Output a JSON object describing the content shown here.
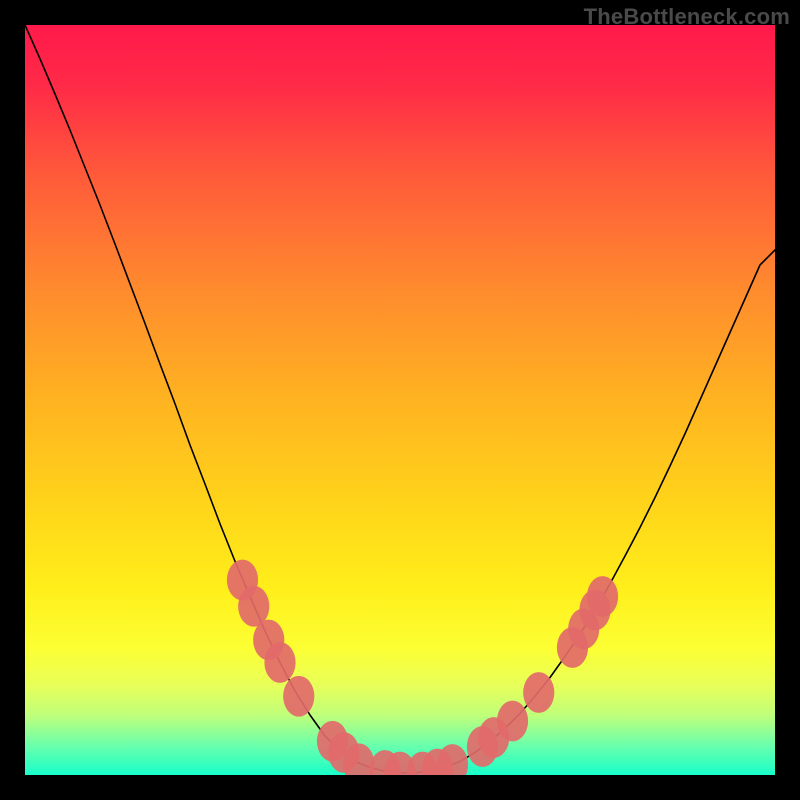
{
  "watermark": "TheBottleneck.com",
  "chart_data": {
    "type": "line",
    "title": "",
    "xlabel": "",
    "ylabel": "",
    "xlim": [
      0,
      100
    ],
    "ylim": [
      0,
      100
    ],
    "background_gradient": {
      "stops": [
        {
          "offset": 0.0,
          "color": "#ff1a4b"
        },
        {
          "offset": 0.08,
          "color": "#ff2a47"
        },
        {
          "offset": 0.2,
          "color": "#ff5a3a"
        },
        {
          "offset": 0.35,
          "color": "#ff8a2e"
        },
        {
          "offset": 0.5,
          "color": "#ffb321"
        },
        {
          "offset": 0.63,
          "color": "#ffd21a"
        },
        {
          "offset": 0.75,
          "color": "#ffee1a"
        },
        {
          "offset": 0.83,
          "color": "#fcff33"
        },
        {
          "offset": 0.88,
          "color": "#e8ff59"
        },
        {
          "offset": 0.92,
          "color": "#c0ff7a"
        },
        {
          "offset": 0.96,
          "color": "#6bffab"
        },
        {
          "offset": 1.0,
          "color": "#18ffca"
        }
      ]
    },
    "series": [
      {
        "name": "curve",
        "color": "#000000",
        "stroke_width": 1.6,
        "x": [
          0,
          2,
          4,
          6,
          8,
          10,
          12,
          14,
          16,
          18,
          20,
          22,
          24,
          26,
          28,
          30,
          32,
          34,
          36,
          38,
          40,
          42,
          44,
          46,
          48,
          50,
          52,
          54,
          56,
          57,
          58,
          60,
          62,
          64,
          66,
          68,
          70,
          72,
          74,
          76,
          78,
          80,
          82,
          84,
          86,
          88,
          90,
          92,
          94,
          96,
          98,
          100
        ],
        "y": [
          100,
          95.5,
          90.8,
          86.0,
          81.0,
          76.0,
          70.8,
          65.5,
          60.2,
          54.8,
          49.5,
          44.0,
          38.8,
          33.5,
          28.5,
          23.8,
          19.2,
          15.0,
          11.2,
          8.0,
          5.2,
          3.2,
          1.8,
          1.0,
          0.5,
          0.3,
          0.3,
          0.5,
          1.0,
          1.4,
          1.8,
          3.0,
          4.5,
          6.2,
          8.2,
          10.5,
          13.0,
          15.8,
          18.8,
          22.0,
          25.5,
          29.2,
          33.0,
          37.0,
          41.2,
          45.5,
          50.0,
          54.5,
          59.0,
          63.5,
          68.0,
          70.0
        ]
      }
    ],
    "markers": {
      "color": "#e26a6a",
      "radius_x": 6.5,
      "radius_y": 8.5,
      "points": [
        {
          "x": 29.0,
          "y": 26.0
        },
        {
          "x": 30.5,
          "y": 22.5
        },
        {
          "x": 32.5,
          "y": 18.0
        },
        {
          "x": 34.0,
          "y": 15.0
        },
        {
          "x": 36.5,
          "y": 10.5
        },
        {
          "x": 41.0,
          "y": 4.5
        },
        {
          "x": 42.5,
          "y": 3.0
        },
        {
          "x": 44.5,
          "y": 1.5
        },
        {
          "x": 48.0,
          "y": 0.6
        },
        {
          "x": 50.0,
          "y": 0.4
        },
        {
          "x": 53.0,
          "y": 0.4
        },
        {
          "x": 55.0,
          "y": 0.8
        },
        {
          "x": 57.0,
          "y": 1.4
        },
        {
          "x": 61.0,
          "y": 3.8
        },
        {
          "x": 62.5,
          "y": 5.0
        },
        {
          "x": 65.0,
          "y": 7.2
        },
        {
          "x": 68.5,
          "y": 11.0
        },
        {
          "x": 73.0,
          "y": 17.0
        },
        {
          "x": 74.5,
          "y": 19.5
        },
        {
          "x": 76.0,
          "y": 22.0
        },
        {
          "x": 77.0,
          "y": 23.8
        }
      ]
    }
  }
}
